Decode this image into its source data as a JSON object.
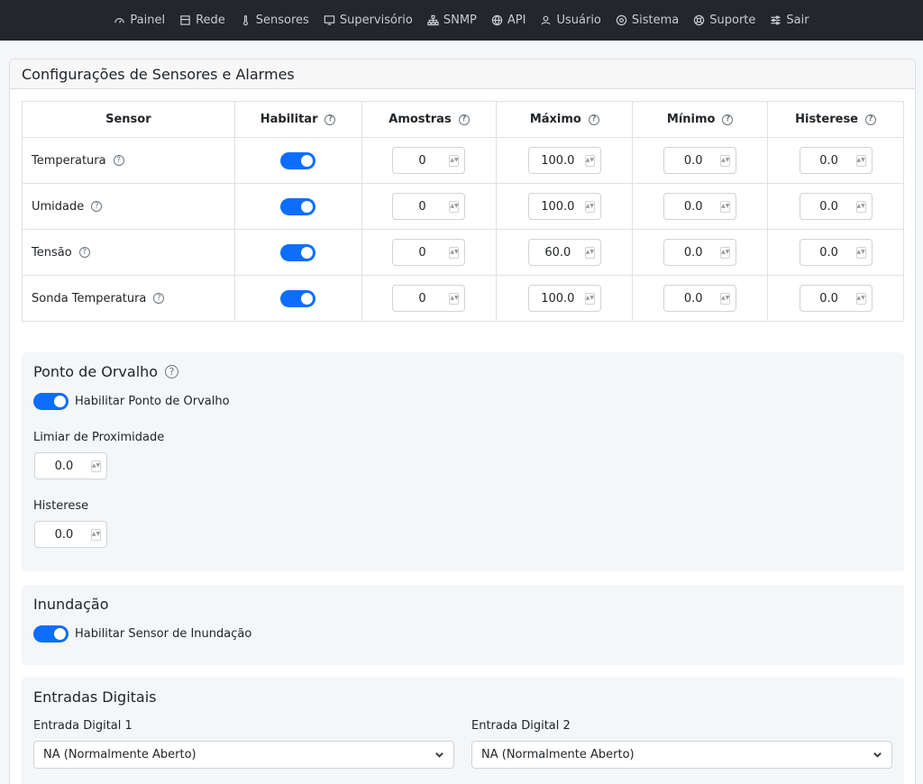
{
  "nav": [
    {
      "label": "Painel",
      "icon": "gauge-icon"
    },
    {
      "label": "Rede",
      "icon": "network-icon"
    },
    {
      "label": "Sensores",
      "icon": "thermometer-icon"
    },
    {
      "label": "Supervisório",
      "icon": "monitor-icon"
    },
    {
      "label": "SNMP",
      "icon": "sitemap-icon"
    },
    {
      "label": "API",
      "icon": "globe-icon"
    },
    {
      "label": "Usuário",
      "icon": "user-icon"
    },
    {
      "label": "Sistema",
      "icon": "system-icon"
    },
    {
      "label": "Suporte",
      "icon": "lifebuoy-icon"
    },
    {
      "label": "Sair",
      "icon": "sliders-icon"
    }
  ],
  "card_title": "Configurações de Sensores e Alarmes",
  "table": {
    "headers": {
      "sensor": "Sensor",
      "enable": "Habilitar",
      "samples": "Amostras",
      "max": "Máximo",
      "min": "Mínimo",
      "hyst": "Histerese"
    },
    "help_glyph": "?",
    "rows": [
      {
        "name": "Temperatura",
        "samples": "0",
        "max": "100.0",
        "min": "0.0",
        "hyst": "0.0"
      },
      {
        "name": "Umidade",
        "samples": "0",
        "max": "100.0",
        "min": "0.0",
        "hyst": "0.0"
      },
      {
        "name": "Tensão",
        "samples": "0",
        "max": "60.0",
        "min": "0.0",
        "hyst": "0.0"
      },
      {
        "name": "Sonda Temperatura",
        "samples": "0",
        "max": "100.0",
        "min": "0.0",
        "hyst": "0.0"
      }
    ]
  },
  "dew": {
    "title": "Ponto de Orvalho",
    "enable_label": "Habilitar Ponto de Orvalho",
    "threshold_label": "Limiar de Proximidade",
    "threshold_value": "0.0",
    "hyst_label": "Histerese",
    "hyst_value": "0.0"
  },
  "flood": {
    "title": "Inundação",
    "enable_label": "Habilitar Sensor de Inundação"
  },
  "digital": {
    "title": "Entradas Digitais",
    "input1_label": "Entrada Digital 1",
    "input1_value": "NA (Normalmente Aberto)",
    "input2_label": "Entrada Digital 2",
    "input2_value": "NA (Normalmente Aberto)"
  },
  "colors": {
    "accent": "#0d6efd",
    "navbar": "#23272b"
  }
}
